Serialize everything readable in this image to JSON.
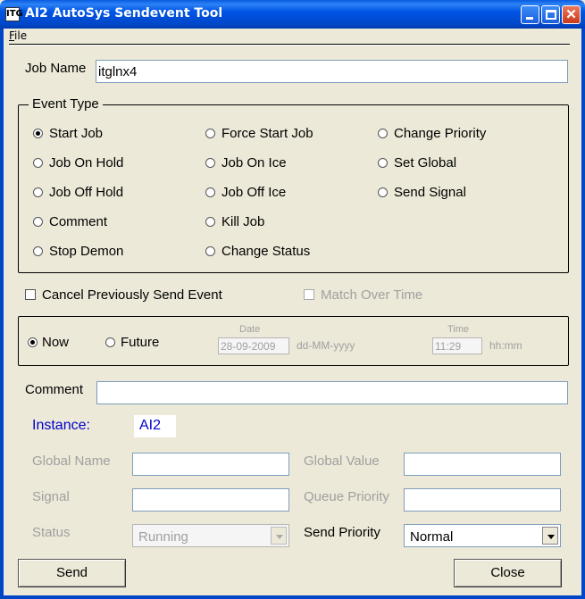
{
  "window": {
    "icon_text": "ITG",
    "title": "AI2 AutoSys Sendevent Tool"
  },
  "menu": {
    "file_underlined": "F",
    "file_rest": "ile"
  },
  "job_name": {
    "label": "Job Name",
    "value": "itglnx4"
  },
  "event_type": {
    "legend": "Event Type",
    "options": [
      {
        "label": "Start Job",
        "checked": true
      },
      {
        "label": "Job On Hold"
      },
      {
        "label": "Job Off Hold"
      },
      {
        "label": "Comment"
      },
      {
        "label": "Stop Demon"
      },
      {
        "label": "Force Start Job"
      },
      {
        "label": "Job On Ice"
      },
      {
        "label": "Job Off Ice"
      },
      {
        "label": "Kill Job"
      },
      {
        "label": "Change Status"
      },
      {
        "label": "Change Priority"
      },
      {
        "label": "Set Global"
      },
      {
        "label": "Send Signal"
      }
    ]
  },
  "cancel_previous": {
    "label": "Cancel Previously Send Event",
    "checked": false
  },
  "match_over_time": {
    "label": "Match Over Time",
    "checked": false
  },
  "schedule": {
    "now_label": "Now",
    "future_label": "Future",
    "date_caption": "Date",
    "date_value": "28-09-2009",
    "date_format": "dd-MM-yyyy",
    "time_caption": "Time",
    "time_value": "11:29",
    "time_format": "hh:mm"
  },
  "comment": {
    "label": "Comment",
    "value": ""
  },
  "instance": {
    "label": "Instance:",
    "value": "AI2"
  },
  "fields": {
    "global_name_label": "Global Name",
    "global_value_label": "Global Value",
    "signal_label": "Signal",
    "queue_priority_label": "Queue Priority",
    "status_label": "Status",
    "status_value": "Running",
    "send_priority_label": "Send Priority",
    "send_priority_value": "Normal"
  },
  "buttons": {
    "send": "Send",
    "close": "Close"
  },
  "colors": {
    "titlebar": "#0055E5",
    "dialog_bg": "#ECE9D8",
    "instance_blue": "#0000CC"
  }
}
